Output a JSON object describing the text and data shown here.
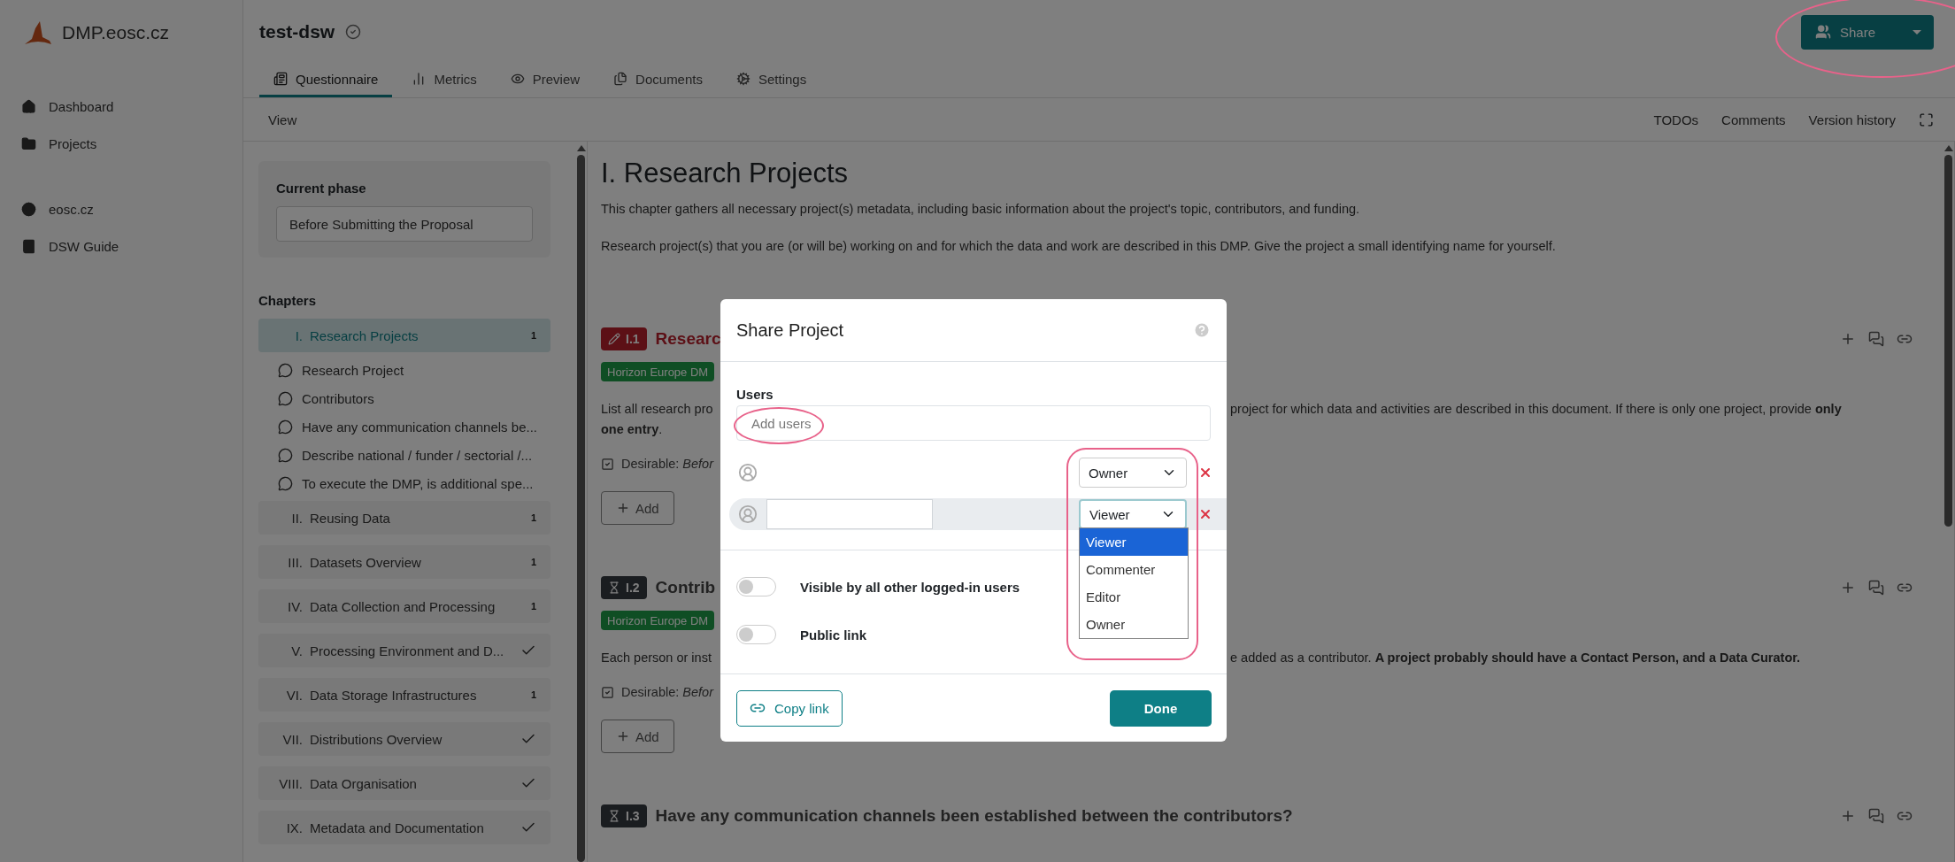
{
  "app": {
    "logo": "DMP.eosc.cz"
  },
  "sidebar": {
    "groups": [
      {
        "items": [
          {
            "label": "Dashboard"
          },
          {
            "label": "Projects"
          }
        ]
      },
      {
        "items": [
          {
            "label": "eosc.cz"
          },
          {
            "label": "DSW Guide"
          }
        ]
      }
    ]
  },
  "project": {
    "title": "test-dsw"
  },
  "share_button": {
    "label": "Share"
  },
  "tabs": [
    {
      "label": "Questionnaire",
      "selected": true
    },
    {
      "label": "Metrics",
      "selected": false
    },
    {
      "label": "Preview",
      "selected": false
    },
    {
      "label": "Documents",
      "selected": false
    },
    {
      "label": "Settings",
      "selected": false
    }
  ],
  "view_bar": {
    "label": "View",
    "links": [
      "TODOs",
      "Comments",
      "Version history"
    ]
  },
  "phase": {
    "label": "Current phase",
    "value": "Before Submitting the Proposal"
  },
  "chapters": {
    "heading": "Chapters",
    "items": [
      {
        "number": "I.",
        "title": "Research Projects",
        "selected": true,
        "complete": false,
        "todos": "1",
        "questions": [
          "Research Project",
          "Contributors",
          "Have any communication channels be...",
          "Describe national / funder / sectorial /...",
          "To execute the DMP, is additional spe..."
        ]
      },
      {
        "number": "II.",
        "title": "Reusing Data",
        "selected": false,
        "complete": false,
        "todos": "1"
      },
      {
        "number": "III.",
        "title": "Datasets Overview",
        "selected": false,
        "complete": false,
        "todos": "1"
      },
      {
        "number": "IV.",
        "title": "Data Collection and Processing",
        "selected": false,
        "complete": false,
        "todos": "1"
      },
      {
        "number": "V.",
        "title": "Processing Environment and D...",
        "selected": false,
        "complete": true
      },
      {
        "number": "VI.",
        "title": "Data Storage Infrastructures",
        "selected": false,
        "complete": false,
        "todos": "1"
      },
      {
        "number": "VII.",
        "title": "Distributions Overview",
        "selected": false,
        "complete": true
      },
      {
        "number": "VIII.",
        "title": "Data Organisation",
        "selected": false,
        "complete": true
      },
      {
        "number": "IX.",
        "title": "Metadata and Documentation",
        "selected": false,
        "complete": true
      }
    ]
  },
  "content": {
    "title": "I. Research Projects",
    "paragraphs": [
      "This chapter gathers all necessary project(s) metadata, including basic information about the project's topic, contributors, and funding.",
      "Research project(s) that you are (or will be) working on and for which the data and work are described in this DMP. Give the project a small identifying name for yourself."
    ],
    "questions": [
      {
        "number": "I.1",
        "kind": "answered",
        "title": "Researc",
        "tag": "Horizon Europe DM",
        "text_left": "List all research pro",
        "text_right": "project for which data and activities are described in this document. If there is only one project, provide **only**",
        "text_more": "**one entry**.",
        "desirable": "Desirable: *Befor*",
        "add_label": "Add"
      },
      {
        "number": "I.2",
        "kind": "pending",
        "title": "Contrib",
        "tag": "Horizon Europe DM",
        "text_left": "Each person or inst",
        "text_right": "e added as a contributor. **A project probably should have a Contact Person, and a Data Curator.**",
        "desirable": "Desirable: *Befor*",
        "add_label": "Add"
      },
      {
        "number": "I.3",
        "kind": "pending",
        "title": "Have any communication channels been established between the contributors?"
      }
    ]
  },
  "dialog": {
    "title": "Share Project",
    "users_label": "Users",
    "users_placeholder": "Add users",
    "users": [
      {
        "role": "Owner",
        "highlighted": false,
        "redacted": false,
        "open": false
      },
      {
        "role": "Viewer",
        "highlighted": true,
        "redacted": true,
        "open": true
      }
    ],
    "role_options": [
      {
        "label": "Viewer",
        "selected": true
      },
      {
        "label": "Commenter",
        "selected": false
      },
      {
        "label": "Editor",
        "selected": false
      },
      {
        "label": "Owner",
        "selected": false
      }
    ],
    "toggles": [
      {
        "label": "Visible by all other logged-in users",
        "on": false
      },
      {
        "label": "Public link",
        "on": false
      }
    ],
    "copy_link": "Copy link",
    "done": "Done"
  }
}
